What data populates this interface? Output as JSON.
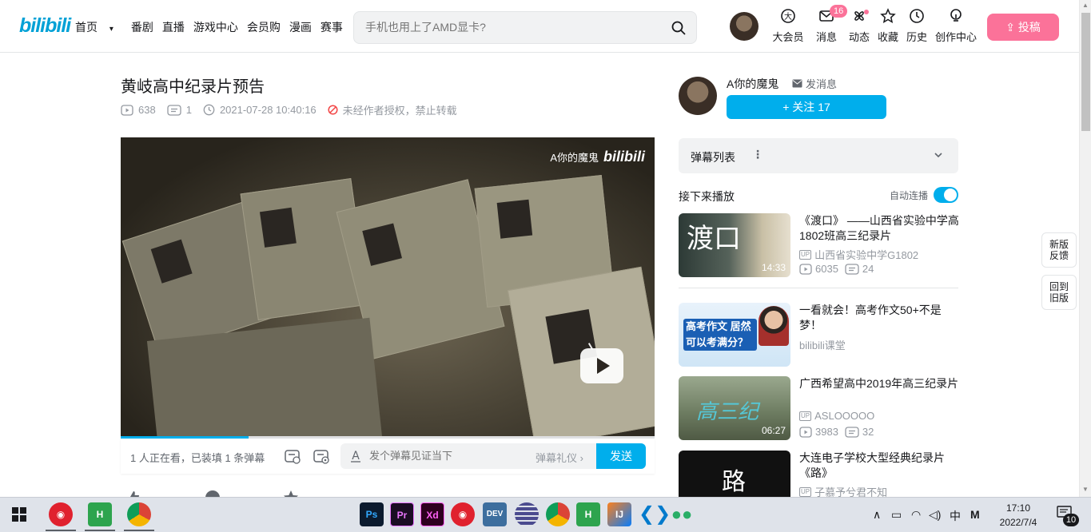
{
  "header": {
    "logo": "bilibili",
    "nav": [
      "首页",
      "番剧",
      "直播",
      "游戏中心",
      "会员购",
      "漫画",
      "赛事"
    ],
    "search_placeholder": "手机也用上了AMD显卡?",
    "tools": [
      {
        "label": "大会员",
        "icon": "vip-icon"
      },
      {
        "label": "消息",
        "icon": "message-icon",
        "badge": "16"
      },
      {
        "label": "动态",
        "icon": "dynamic-icon"
      },
      {
        "label": "收藏",
        "icon": "favorite-star-icon"
      },
      {
        "label": "历史",
        "icon": "history-clock-icon"
      },
      {
        "label": "创作中心",
        "icon": "creator-bulb-icon"
      }
    ],
    "upload_label": "投稿"
  },
  "video": {
    "title": "黄岐高中纪录片预告",
    "views": "638",
    "danmaku_count": "1",
    "date": "2021-07-28 10:40:16",
    "reprint_notice": "未经作者授权，禁止转载",
    "watermark_user": "A你的魔鬼",
    "watermark_logo": "bilibili",
    "progress_fraction": 0.24
  },
  "danmaku_bar": {
    "info": "1 人正在看，已装填 1 条弹幕",
    "input_placeholder": "发个弹幕见证当下",
    "etiquette": "弹幕礼仪 ›",
    "send": "发送"
  },
  "uploader": {
    "name": "A你的魔鬼",
    "message": "发消息",
    "follow": "+ 关注 17"
  },
  "sidebar": {
    "danmaku_list": "弹幕列表",
    "next_label": "接下来播放",
    "autoplay": "自动连播",
    "recommendations": [
      {
        "title": "《渡口》 ——山西省实验中学高1802班高三纪录片",
        "author": "山西省实验中学G1802",
        "views": "6035",
        "danmaku": "24",
        "duration": "14:33",
        "thumb_text": "渡口"
      },
      {
        "title": "一看就会！高考作文50+不是梦！",
        "author": "bilibili课堂",
        "views": "",
        "danmaku": "",
        "duration": "",
        "thumb_text": "高考作文 居然可以考满分？"
      },
      {
        "title": "广西希望高中2019年高三纪录片",
        "author": "ASLOOOOO",
        "views": "3983",
        "danmaku": "32",
        "duration": "06:27",
        "thumb_text": "高三纪"
      },
      {
        "title": "大连电子学校大型经典纪录片《路》",
        "author": "子慕予兮君不知",
        "views": "",
        "danmaku": "",
        "duration": "",
        "thumb_text": "路"
      }
    ]
  },
  "side_buttons": [
    "新版反馈",
    "回到旧版"
  ],
  "taskbar": {
    "time": "17:10",
    "date": "2022/7/4",
    "ime": "中",
    "notifications": "10",
    "apps": [
      "Ps",
      "Pr",
      "Xd",
      "DEV",
      "IJ"
    ]
  },
  "colors": {
    "accent": "#00aeec",
    "brand_pink": "#fb7299",
    "logo_blue": "#00a1d6"
  }
}
